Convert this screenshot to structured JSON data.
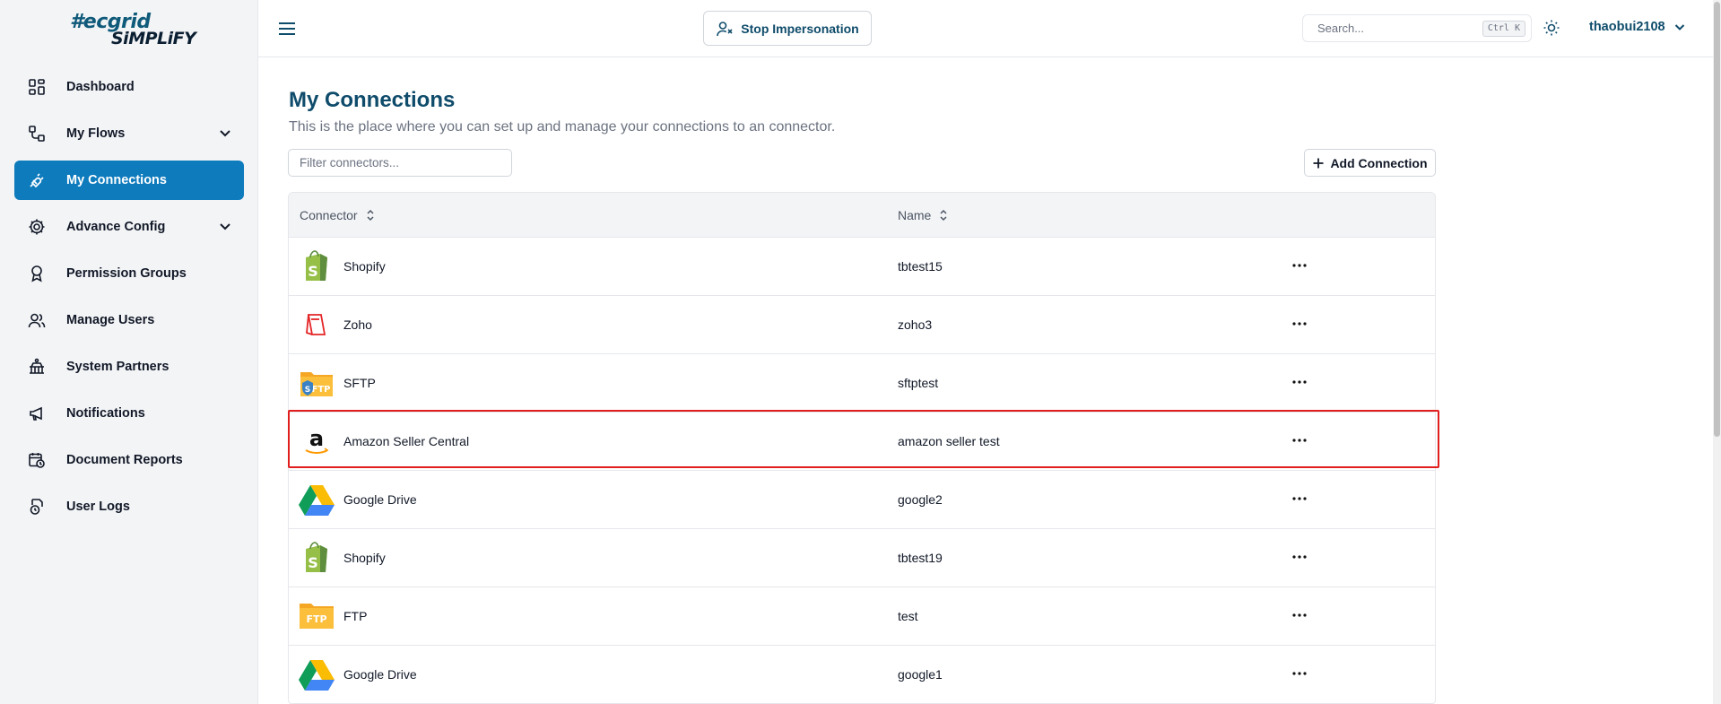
{
  "brand": {
    "line1": "#ecgrid",
    "line2": "SiMPLiFY"
  },
  "sidebar": {
    "items": [
      {
        "label": "Dashboard",
        "icon": "dashboard-icon",
        "expandable": false,
        "active": false
      },
      {
        "label": "My Flows",
        "icon": "flows-icon",
        "expandable": true,
        "active": false
      },
      {
        "label": "My Connections",
        "icon": "plug-icon",
        "expandable": false,
        "active": true
      },
      {
        "label": "Advance Config",
        "icon": "gear-icon",
        "expandable": true,
        "active": false
      },
      {
        "label": "Permission Groups",
        "icon": "badge-icon",
        "expandable": false,
        "active": false
      },
      {
        "label": "Manage Users",
        "icon": "users-icon",
        "expandable": false,
        "active": false
      },
      {
        "label": "System Partners",
        "icon": "partners-icon",
        "expandable": false,
        "active": false
      },
      {
        "label": "Notifications",
        "icon": "megaphone-icon",
        "expandable": false,
        "active": false
      },
      {
        "label": "Document Reports",
        "icon": "calendar-clock-icon",
        "expandable": false,
        "active": false
      },
      {
        "label": "User Logs",
        "icon": "logs-icon",
        "expandable": false,
        "active": false
      }
    ]
  },
  "header": {
    "stop_label": "Stop Impersonation",
    "search_placeholder": "Search...",
    "search_shortcut": "Ctrl K",
    "username": "thaobui2108"
  },
  "main": {
    "title": "My Connections",
    "subtitle": "This is the place where you can set up and manage your connections to an connector.",
    "filter_placeholder": "Filter connectors...",
    "add_label": "Add Connection",
    "columns": {
      "connector": "Connector",
      "name": "Name"
    },
    "rows": [
      {
        "connector": "Shopify",
        "name": "tbtest15",
        "logo": "shopify"
      },
      {
        "connector": "Zoho",
        "name": "zoho3",
        "logo": "zoho"
      },
      {
        "connector": "SFTP",
        "name": "sftptest",
        "logo": "sftp"
      },
      {
        "connector": "Amazon Seller Central",
        "name": "amazon seller test",
        "logo": "amazon",
        "highlighted": true
      },
      {
        "connector": "Google Drive",
        "name": "google2",
        "logo": "gdrive"
      },
      {
        "connector": "Shopify",
        "name": "tbtest19",
        "logo": "shopify"
      },
      {
        "connector": "FTP",
        "name": "test",
        "logo": "ftp"
      },
      {
        "connector": "Google Drive",
        "name": "google1",
        "logo": "gdrive"
      }
    ]
  },
  "colors": {
    "accent": "#0e7bbd",
    "title": "#0f4c6b",
    "highlight": "#e11d1d"
  }
}
